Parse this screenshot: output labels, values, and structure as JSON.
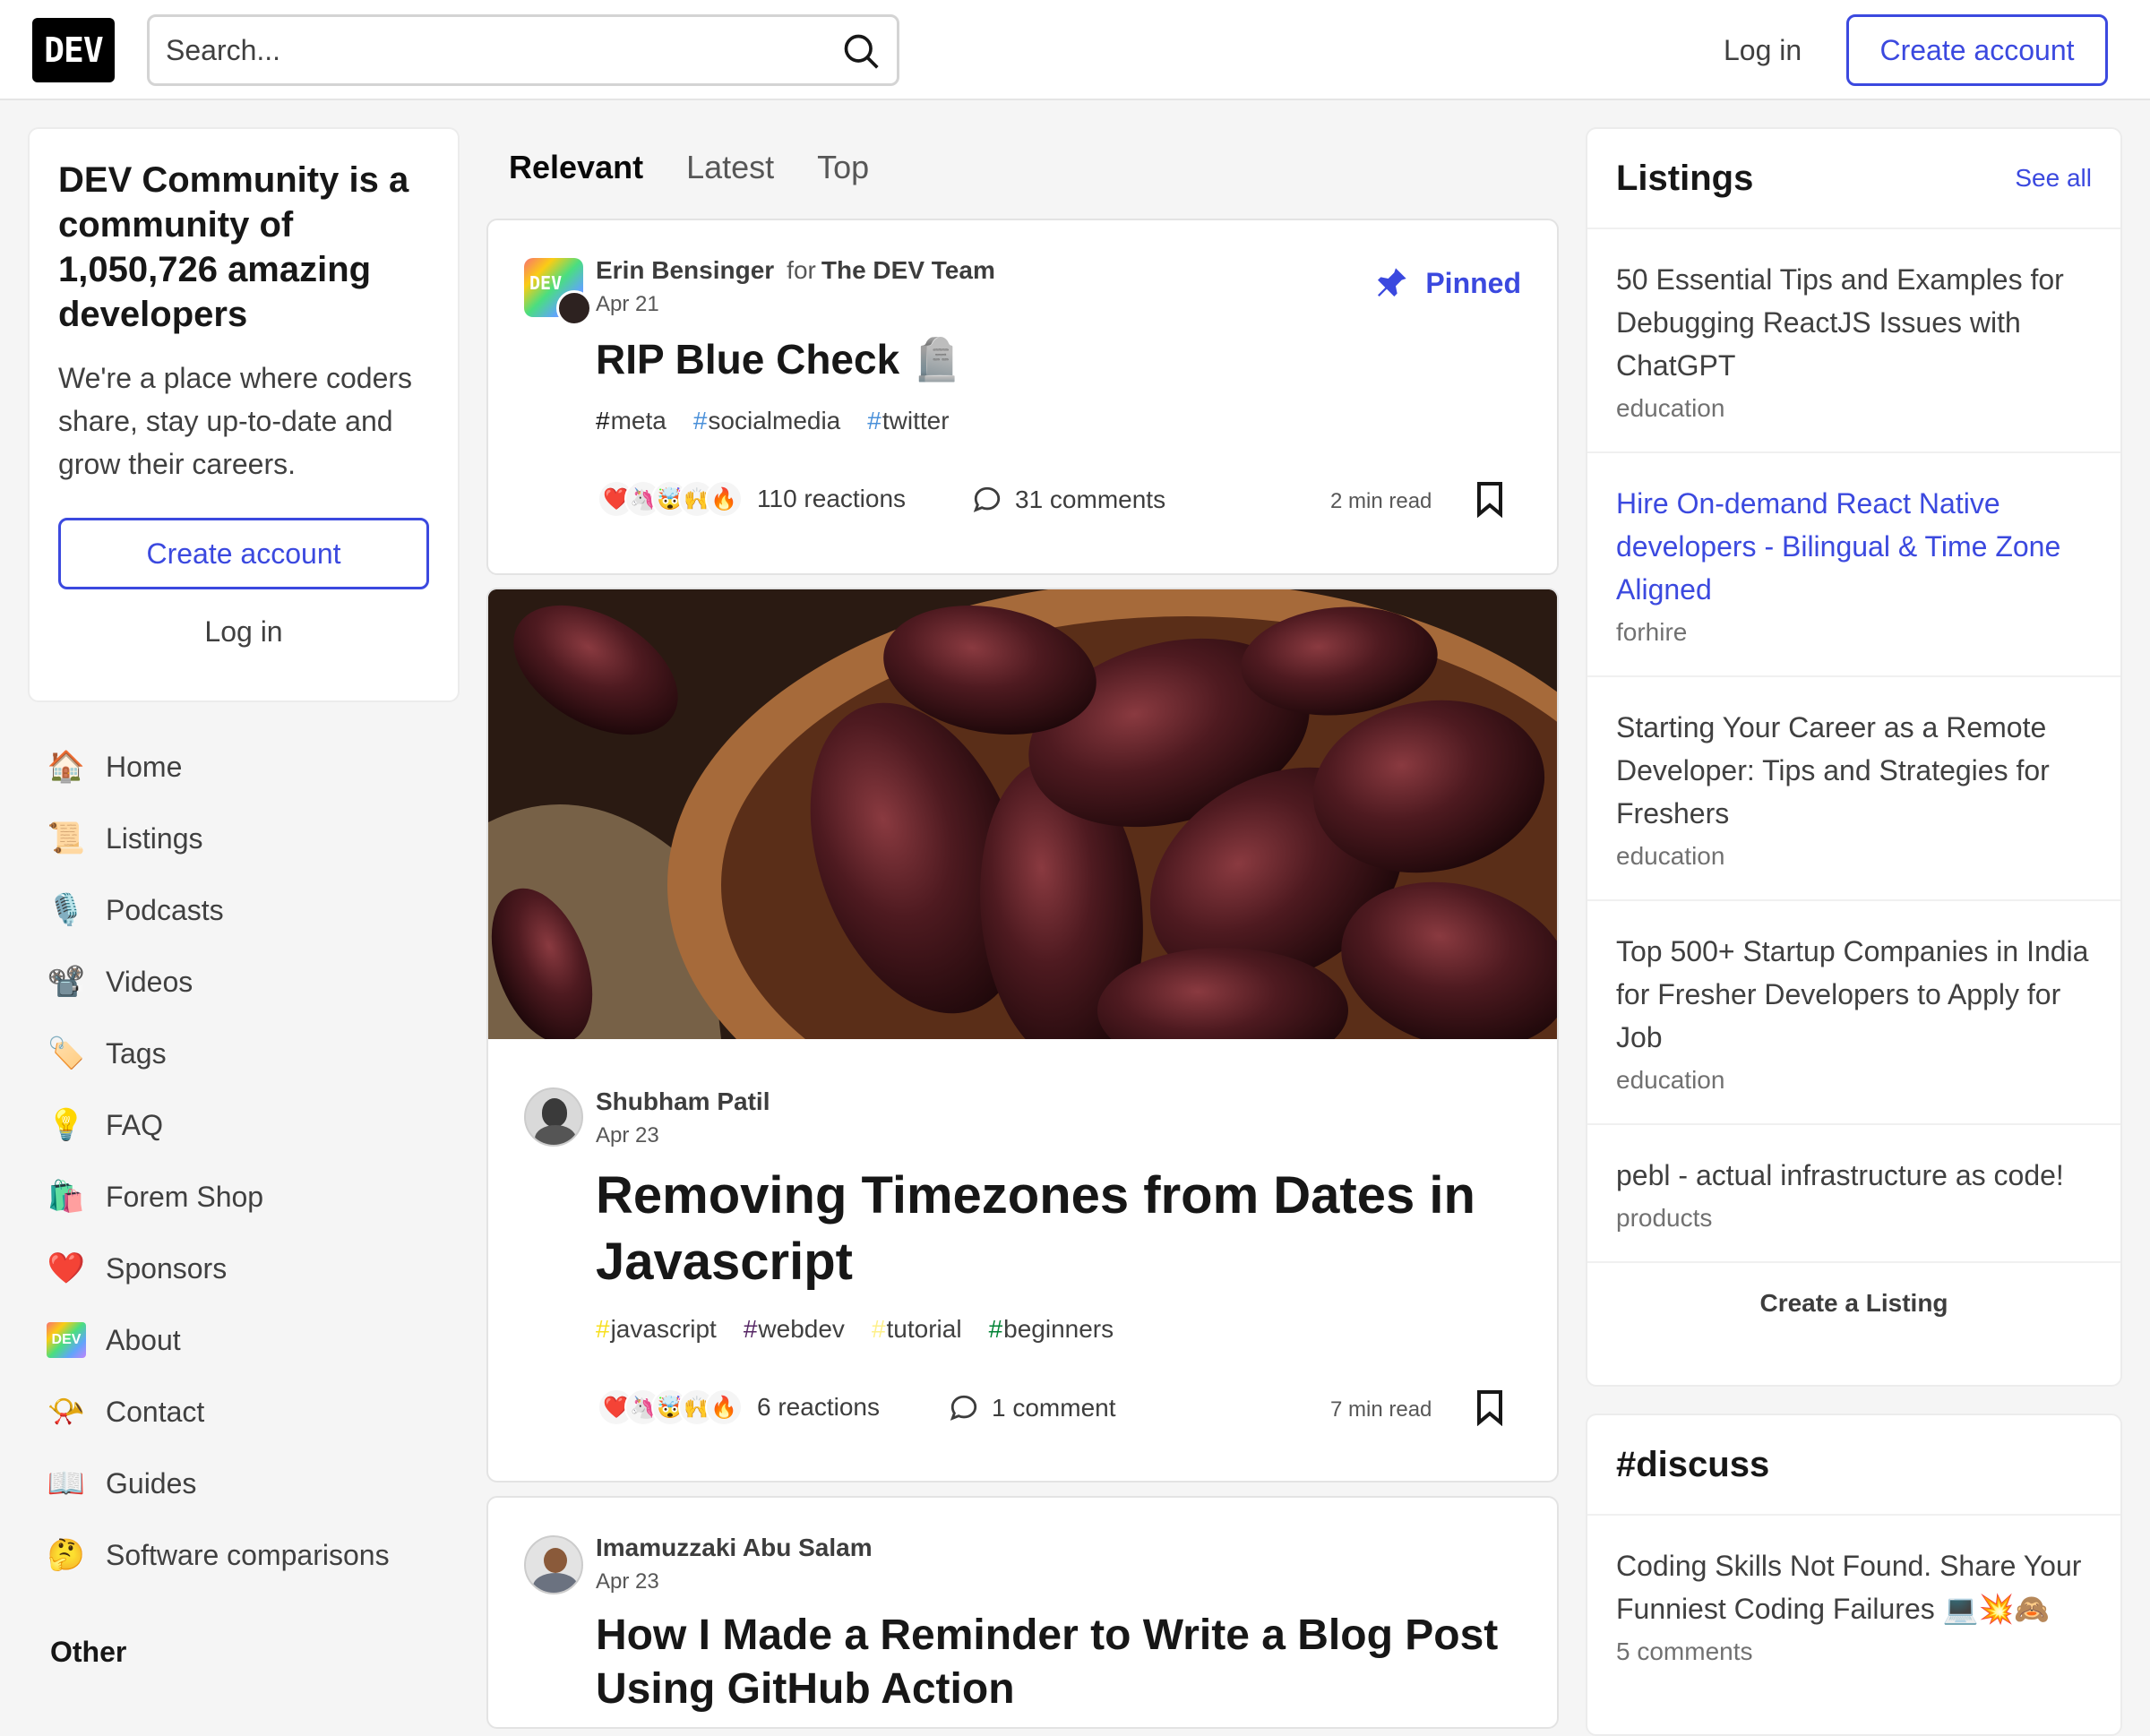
{
  "header": {
    "logo": "DEV",
    "search_placeholder": "Search...",
    "login": "Log in",
    "create_account": "Create account"
  },
  "welcome": {
    "heading": "DEV Community is a community of 1,050,726 amazing developers",
    "body": "We're a place where coders share, stay up-to-date and grow their careers.",
    "create_account": "Create account",
    "login": "Log in"
  },
  "nav": {
    "items": [
      {
        "label": "Home",
        "icon": "🏠"
      },
      {
        "label": "Listings",
        "icon": "📜"
      },
      {
        "label": "Podcasts",
        "icon": "🎙️"
      },
      {
        "label": "Videos",
        "icon": "📽️"
      },
      {
        "label": "Tags",
        "icon": "🏷️"
      },
      {
        "label": "FAQ",
        "icon": "💡"
      },
      {
        "label": "Forem Shop",
        "icon": "🛍️"
      },
      {
        "label": "Sponsors",
        "icon": "❤️"
      },
      {
        "label": "About",
        "icon": "DEV"
      },
      {
        "label": "Contact",
        "icon": "📯"
      },
      {
        "label": "Guides",
        "icon": "📖"
      },
      {
        "label": "Software comparisons",
        "icon": "🤔"
      }
    ],
    "other_heading": "Other"
  },
  "feed": {
    "tabs": [
      "Relevant",
      "Latest",
      "Top"
    ],
    "posts": [
      {
        "author": "Erin Bensinger",
        "for_label": "for",
        "org": "The DEV Team",
        "date": "Apr 21",
        "pinned": "Pinned",
        "title": "RIP Blue Check 🪦",
        "tags": [
          {
            "hash": "#",
            "name": "meta",
            "color": "#171717"
          },
          {
            "hash": "#",
            "name": "socialmedia",
            "color": "#4a90d9"
          },
          {
            "hash": "#",
            "name": "twitter",
            "color": "#4a90d9"
          }
        ],
        "reactions": "110 reactions",
        "comments": "31 comments",
        "read_time": "2 min read"
      },
      {
        "author": "Shubham Patil",
        "date": "Apr 23",
        "title": "Removing Timezones from Dates in Javascript",
        "tags": [
          {
            "hash": "#",
            "name": "javascript",
            "color": "#f7df1e"
          },
          {
            "hash": "#",
            "name": "webdev",
            "color": "#562765"
          },
          {
            "hash": "#",
            "name": "tutorial",
            "color": "#fef08a"
          },
          {
            "hash": "#",
            "name": "beginners",
            "color": "#008335"
          }
        ],
        "reactions": "6 reactions",
        "comments": "1 comment",
        "read_time": "7 min read"
      },
      {
        "author": "Imamuzzaki Abu Salam",
        "date": "Apr 23",
        "title": "How I Made a Reminder to Write a Blog Post Using GitHub Action"
      }
    ],
    "reaction_emojis": [
      "❤️",
      "🦄",
      "🤯",
      "🙌",
      "🔥"
    ]
  },
  "listings": {
    "heading": "Listings",
    "see_all": "See all",
    "items": [
      {
        "title": "50 Essential Tips and Examples for Debugging ReactJS Issues with ChatGPT",
        "category": "education",
        "highlight": false
      },
      {
        "title": "Hire On-demand React Native developers - Bilingual & Time Zone Aligned",
        "category": "forhire",
        "highlight": true
      },
      {
        "title": "Starting Your Career as a Remote Developer: Tips and Strategies for Freshers",
        "category": "education",
        "highlight": false
      },
      {
        "title": "Top 500+ Startup Companies in India for Fresher Developers to Apply for Job",
        "category": "education",
        "highlight": false
      },
      {
        "title": "pebl - actual infrastructure as code!",
        "category": "products",
        "highlight": false
      }
    ],
    "create_listing": "Create a Listing"
  },
  "discuss": {
    "heading": "#discuss",
    "items": [
      {
        "title": "Coding Skills Not Found. Share Your Funniest Coding Failures 💻💥🙈",
        "comments": "5 comments"
      }
    ]
  },
  "colors": {
    "accent": "#3b49df",
    "background": "#f5f5f5"
  }
}
